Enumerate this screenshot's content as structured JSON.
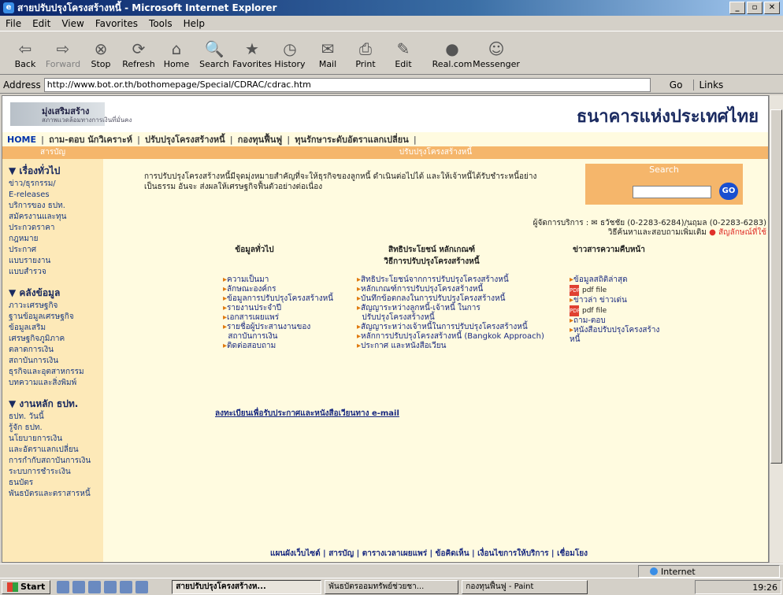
{
  "window": {
    "title": "สายปรับปรุงโครงสร้างหนี้ - Microsoft Internet Explorer",
    "minimize": "_",
    "maximize": "▫",
    "close": "✕"
  },
  "menu": [
    "File",
    "Edit",
    "View",
    "Favorites",
    "Tools",
    "Help"
  ],
  "toolbar": [
    {
      "label": "Back",
      "icon": "⇦"
    },
    {
      "label": "Forward",
      "icon": "⇨"
    },
    {
      "label": "Stop",
      "icon": "⊗"
    },
    {
      "label": "Refresh",
      "icon": "⟳"
    },
    {
      "label": "Home",
      "icon": "⌂"
    },
    {
      "label": "Search",
      "icon": "🔍"
    },
    {
      "label": "Favorites",
      "icon": "★"
    },
    {
      "label": "History",
      "icon": "◷"
    },
    {
      "label": "Mail",
      "icon": "✉"
    },
    {
      "label": "Print",
      "icon": "⎙"
    },
    {
      "label": "Edit",
      "icon": "✎"
    },
    {
      "label": "Real.com",
      "icon": "●"
    },
    {
      "label": "Messenger",
      "icon": "☺"
    }
  ],
  "address": {
    "label": "Address",
    "url": "http://www.bot.or.th/bothomepage/Special/CDRAC/cdrac.htm",
    "go": "Go",
    "links": "Links"
  },
  "page": {
    "logo_left_title": "มุ่งเสริมสร้าง",
    "logo_left_sub": "สภาพแวดล้อมทางการเงินที่มั่นคง",
    "logo_right": "ธนาคารแห่งประเทศไทย",
    "nav": [
      "HOME",
      "ถาม-ตอบ นักวิเคราะห์",
      "ปรับปรุงโครงสร้างหนี้",
      "กองทุนฟื้นฟู",
      "ทุนรักษาระดับอัตราแลกเปลี่ยน"
    ],
    "bar_left": "สารบัญ",
    "bar_center": "ปรับปรุงโครงสร้างหนี้",
    "sidebar": [
      {
        "heading": "▼ เรื่องทั่วไป",
        "items": [
          "ข่าว/ธุรกรรม/",
          "E-releases",
          "บริการของ ธปท.",
          "สมัครงานและทุน",
          "ประกวดราคา",
          "กฎหมาย",
          "ประกาศ",
          "แบบรายงาน",
          "แบบสำรวจ"
        ]
      },
      {
        "heading": "▼ คลังข้อมูล",
        "items": [
          "ภาวะเศรษฐกิจ",
          "ฐานข้อมูลเศรษฐกิจ",
          "ข้อมูลเสริม",
          "เศรษฐกิจภูมิภาค",
          "ตลาดการเงิน",
          "สถาบันการเงิน",
          "ธุรกิจและอุตสาหกรรม",
          "บทความและสิ่งพิมพ์"
        ]
      },
      {
        "heading": "▼ งานหลัก ธปท.",
        "items": [
          "ธปท. วันนี้",
          "รู้จัก ธปท.",
          "นโยบายการเงิน",
          "และอัตราแลกเปลี่ยน",
          "การกำกับสถาบันการเงิน",
          "ระบบการชำระเงิน",
          "ธนบัตร",
          "พันธบัตรและตราสารหนี้"
        ]
      }
    ],
    "intro": "การปรับปรุงโครงสร้างหนี้มีจุดมุ่งหมายสำคัญที่จะให้ธุรกิจของลูกหนี้ ดำเนินต่อไปได้ และให้เจ้าหนี้ได้รับชำระหนี้อย่างเป็นธรรม อันจะ ส่งผลให้เศรษฐกิจฟื้นตัวอย่างต่อเนื่อง",
    "search_label": "Search",
    "search_value": "",
    "search_go": "GO",
    "contact_line": "ผู้จัดการบริการ : ✉ ธวัชชัย (0-2283-6284)/นฤมล (0-2283-6283)",
    "contact_link": "วิธีค้นหาและสอบถามเพิ่มเติม",
    "contact_sym": "● สัญลักษณ์ที่ใช้",
    "col1_head": "ข้อมูลทั่วไป",
    "col2_head": "สิทธิประโยชน์ หลักเกณฑ์\nวิธีการปรับปรุงโครงสร้างหนี้",
    "col3_head": "ข่าวสารความคืบหน้า",
    "col1": [
      "ความเป็นมา",
      "ลักษณะองค์กร",
      "ข้อมูลการปรับปรุงโครงสร้างหนี้",
      "รายงานประจำปี",
      "เอกสารเผยแพร่",
      "รายชื่อผู้ประสานงานของ",
      "สถาบันการเงิน",
      "ติดต่อสอบถาม"
    ],
    "col2": [
      "สิทธิประโยชน์จากการปรับปรุงโครงสร้างหนี้",
      "หลักเกณฑ์การปรับปรุงโครงสร้างหนี้",
      "บันทึกข้อตกลงในการปรับปรุงโครงสร้างหนี้",
      "สัญญาระหว่างลูกหนี้-เจ้าหนี้ ในการ",
      "ปรับปรุงโครงสร้างหนี้",
      "สัญญาระหว่างเจ้าหนี้ในการปรับปรุงโครงสร้างหนี้",
      "หลักการปรับปรุงโครงสร้างหนี้ (Bangkok Approach)",
      "ประกาศ และหนังสือเวียน"
    ],
    "col3": [
      "ข้อมูลสถิติล่าสุด",
      "pdf file",
      "ข่าวล่า ข่าวเด่น",
      "pdf file",
      "ถาม-ตอบ",
      "หนังสือปรับปรุงโครงสร้าง",
      "หนี้"
    ],
    "register": "ลงทะเบียนเพื่อรับประกาศและหนังสือเวียนทาง e-mail",
    "footer": "แผนผังเว็บไซต์ | สารบัญ | ตารางเวลาเผยแพร่ | ข้อคิดเห็น | เงื่อนไขการให้บริการ | เชื่อมโยง"
  },
  "status": {
    "left": "",
    "zone": "Internet"
  },
  "taskbar": {
    "start": "Start",
    "tasks": [
      "สายปรับปรุงโครงสร้างห...",
      "พันธบัตรออมทรัพย์ช่วยชา...",
      "กองทุนฟื้นฟู - Paint"
    ],
    "clock": "19:26"
  }
}
